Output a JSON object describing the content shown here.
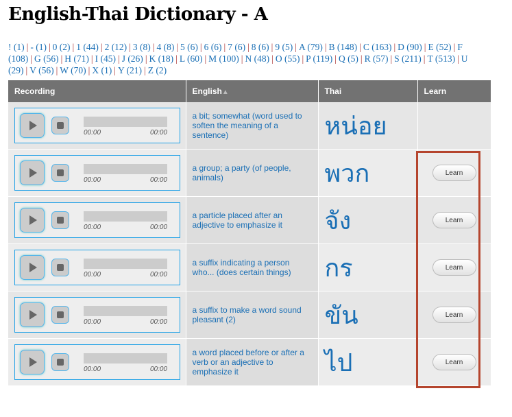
{
  "title": "English-Thai Dictionary - A",
  "index": [
    "! (1)",
    "- (1)",
    "0 (2)",
    "1 (44)",
    "2 (12)",
    "3 (8)",
    "4 (8)",
    "5 (6)",
    "6 (6)",
    "7 (6)",
    "8 (6)",
    "9 (5)",
    "A (79)",
    "B (148)",
    "C (163)",
    "D (90)",
    "E (52)",
    "F (108)",
    "G (56)",
    "H (71)",
    "I (45)",
    "J (26)",
    "K (18)",
    "L (60)",
    "M (100)",
    "N (48)",
    "O (55)",
    "P (119)",
    "Q (5)",
    "R (57)",
    "S (211)",
    "T (513)",
    "U (29)",
    "V (56)",
    "W (70)",
    "X (1)",
    "Y (21)",
    "Z (2)"
  ],
  "headers": {
    "recording": "Recording",
    "english": "English",
    "thai": "Thai",
    "learn": "Learn"
  },
  "sort_icon": "triangle-up",
  "time_start": "00:00",
  "time_end": "00:00",
  "learn_label": "Learn",
  "rows": [
    {
      "english": "a bit; somewhat (word used to soften the meaning of a sentence)",
      "thai": "หน่อย",
      "learn": false
    },
    {
      "english": "a group; a party (of people, animals)",
      "thai": "พวก",
      "learn": true
    },
    {
      "english": "a particle placed after an adjective to emphasize it",
      "thai": "จัง",
      "learn": true
    },
    {
      "english": "a suffix indicating a person who... (does certain things)",
      "thai": "กร",
      "learn": true
    },
    {
      "english": "a suffix to make a word sound pleasant (2)",
      "thai": "ขัน",
      "learn": true
    },
    {
      "english": "a word placed before or after a verb or an adjective to emphasize it",
      "thai": "ไป",
      "learn": true
    }
  ],
  "highlight_color": "#b5452e"
}
